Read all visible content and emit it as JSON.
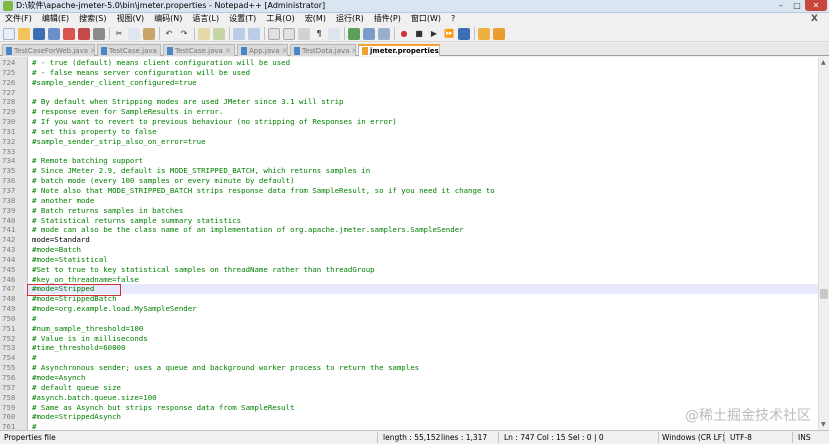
{
  "window": {
    "title": "D:\\软件\\apache-jmeter-5.0\\bin\\jmeter.properties - Notepad++ [Administrator]"
  },
  "menu": [
    "文件(F)",
    "编辑(E)",
    "搜索(S)",
    "视图(V)",
    "编码(N)",
    "语言(L)",
    "设置(T)",
    "工具(O)",
    "宏(M)",
    "运行(R)",
    "插件(P)",
    "窗口(W)",
    "?"
  ],
  "menu_close": "X",
  "tabs": [
    {
      "label": "TestCaseForWeb.java"
    },
    {
      "label": "TestCase.java"
    },
    {
      "label": "TestCase.java"
    },
    {
      "label": "App.java"
    },
    {
      "label": "TestData.java"
    },
    {
      "label": "jmeter.properties",
      "active": true
    }
  ],
  "editor": {
    "lines": [
      {
        "n": "724",
        "text": "# - true (default) means client configuration will be used"
      },
      {
        "n": "725",
        "text": "# - false means server configuration will be used"
      },
      {
        "n": "726",
        "text": "#sample_sender_client_configured=true"
      },
      {
        "n": "727",
        "text": ""
      },
      {
        "n": "728",
        "text": "# By default when Stripping modes are used JMeter since 3.1 will strip"
      },
      {
        "n": "729",
        "text": "# response even for SampleResults in error."
      },
      {
        "n": "730",
        "text": "# If you want to revert to previous behaviour (no stripping of Responses in error)"
      },
      {
        "n": "731",
        "text": "# set this property to false"
      },
      {
        "n": "732",
        "text": "#sample_sender_strip_also_on_error=true"
      },
      {
        "n": "733",
        "text": ""
      },
      {
        "n": "734",
        "text": "# Remote batching support"
      },
      {
        "n": "735",
        "text": "# Since JMeter 2.9, default is MODE_STRIPPED_BATCH, which returns samples in"
      },
      {
        "n": "736",
        "text": "# batch mode (every 100 samples or every minute by default)"
      },
      {
        "n": "737",
        "text": "# Note also that MODE_STRIPPED_BATCH strips response data from SampleResult, so if you need it change to"
      },
      {
        "n": "738",
        "text": "# another mode"
      },
      {
        "n": "739",
        "text": "# Batch returns samples in batches"
      },
      {
        "n": "740",
        "text": "# Statistical returns sample summary statistics"
      },
      {
        "n": "741",
        "text": "# mode can also be the class name of an implementation of org.apache.jmeter.samplers.SampleSender"
      },
      {
        "n": "742",
        "text": "mode=Standard",
        "key": true
      },
      {
        "n": "743",
        "text": "#mode=Batch"
      },
      {
        "n": "744",
        "text": "#mode=Statistical"
      },
      {
        "n": "745",
        "text": "#Set to true to key statistical samples on threadName rather than threadGroup"
      },
      {
        "n": "746",
        "text": "#key_on_threadname=false"
      },
      {
        "n": "747",
        "text": "#mode=Stripped",
        "current": true
      },
      {
        "n": "748",
        "text": "#mode=StrippedBatch"
      },
      {
        "n": "749",
        "text": "#mode=org.example.load.MySampleSender"
      },
      {
        "n": "750",
        "text": "#"
      },
      {
        "n": "751",
        "text": "#num_sample_threshold=100"
      },
      {
        "n": "752",
        "text": "# Value is in milliseconds"
      },
      {
        "n": "753",
        "text": "#time_threshold=60000"
      },
      {
        "n": "754",
        "text": "#"
      },
      {
        "n": "755",
        "text": "# Asynchronous sender; uses a queue and background worker process to return the samples"
      },
      {
        "n": "756",
        "text": "#mode=Asynch"
      },
      {
        "n": "757",
        "text": "# default queue size"
      },
      {
        "n": "758",
        "text": "#asynch.batch.queue.size=100"
      },
      {
        "n": "759",
        "text": "# Same as Asynch but strips response data from SampleResult"
      },
      {
        "n": "760",
        "text": "#mode=StrippedAsynch"
      },
      {
        "n": "761",
        "text": "#"
      }
    ]
  },
  "watermark": "@稀土掘金技术社区",
  "status": {
    "filetype": "Properties file",
    "length": "length : 55,152",
    "lines": "lines : 1,317",
    "position": "Ln : 747    Col : 15    Sel : 0 | 0",
    "eol": "Windows (CR LF)",
    "encoding": "UTF-8",
    "mode": "INS"
  },
  "colors": {
    "comment": "#008000",
    "highlight_box": "#d23030",
    "current_line": "#e8e8ff"
  }
}
